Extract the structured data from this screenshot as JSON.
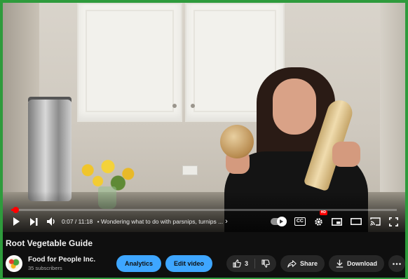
{
  "player": {
    "current_time": "0:07",
    "duration": "11:18",
    "time_separator": " / ",
    "chapter_title": "Wondering what to do with parsnips, turnips ...",
    "progress_fraction": 0.0103,
    "accent_color": "#ff0000"
  },
  "video": {
    "title": "Root Vegetable Guide"
  },
  "channel": {
    "name": "Food for People Inc.",
    "subscribers": "35 subscribers"
  },
  "actions": {
    "analytics_label": "Analytics",
    "edit_video_label": "Edit video",
    "like_count": "3",
    "share_label": "Share",
    "download_label": "Download"
  },
  "icons": {
    "play": "play-icon",
    "next": "next-icon",
    "volume": "volume-icon",
    "autoplay": "autoplay-toggle",
    "captions": "captions-icon",
    "settings": "gear-icon",
    "miniplayer": "miniplayer-icon",
    "theater": "theater-mode-icon",
    "cast": "cast-icon",
    "fullscreen": "fullscreen-icon",
    "like": "thumbs-up-icon",
    "dislike": "thumbs-down-icon",
    "share": "share-icon",
    "download": "download-icon",
    "more": "more-horizontal-icon"
  },
  "colors": {
    "frame": "#2e9b3c",
    "primary_button": "#3ea6ff",
    "secondary_button": "#272727",
    "background": "#0f0f0f"
  }
}
